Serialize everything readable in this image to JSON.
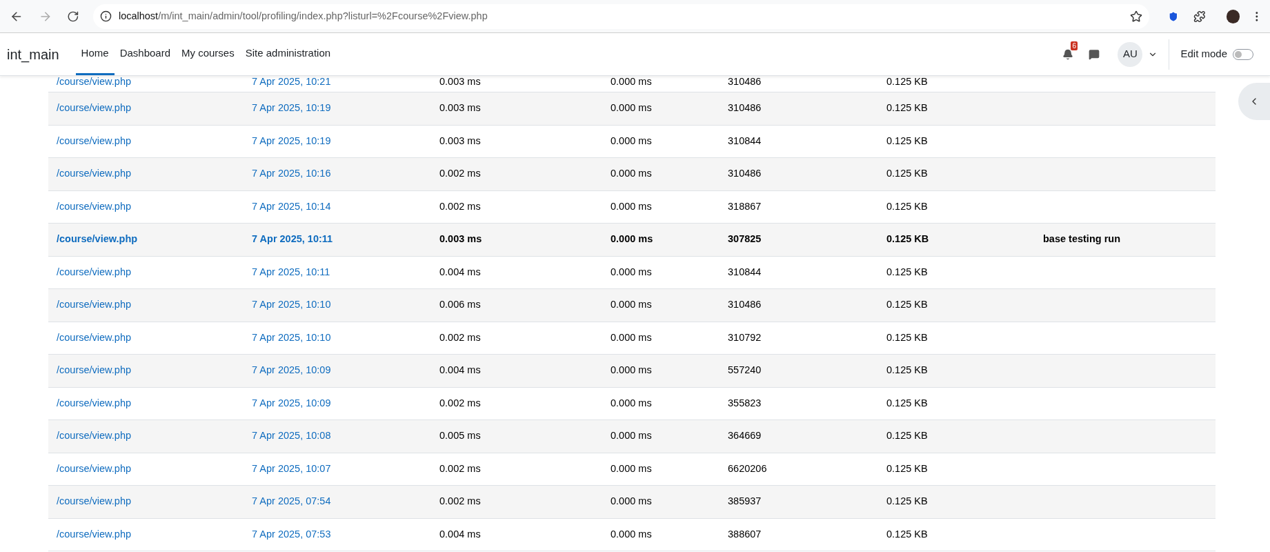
{
  "browser": {
    "url_host": "localhost",
    "url_path": "/m/int_main/admin/tool/profiling/index.php?listurl=%2Fcourse%2Fview.php"
  },
  "navbar": {
    "brand": "int_main",
    "items": [
      {
        "label": "Home",
        "selected": true
      },
      {
        "label": "Dashboard",
        "selected": false
      },
      {
        "label": "My courses",
        "selected": false
      },
      {
        "label": "Site administration",
        "selected": false
      }
    ],
    "notification_count": "6",
    "avatar_initials": "AU",
    "edit_mode": {
      "label": "Edit mode",
      "on": false
    }
  },
  "table": {
    "rows": [
      {
        "url": "/course/view.php",
        "date": "7 Apr 2025, 10:21",
        "column_3": "0.003 ms",
        "column_4": "0.000 ms",
        "column_5": "310486",
        "column_6": "0.125 KB",
        "reference": false
      },
      {
        "url": "/course/view.php",
        "date": "7 Apr 2025, 10:19",
        "column_3": "0.003 ms",
        "column_4": "0.000 ms",
        "column_5": "310486",
        "column_6": "0.125 KB",
        "reference": false
      },
      {
        "url": "/course/view.php",
        "date": "7 Apr 2025, 10:19",
        "column_3": "0.003 ms",
        "column_4": "0.000 ms",
        "column_5": "310844",
        "column_6": "0.125 KB",
        "reference": false
      },
      {
        "url": "/course/view.php",
        "date": "7 Apr 2025, 10:16",
        "column_3": "0.002 ms",
        "column_4": "0.000 ms",
        "column_5": "310486",
        "column_6": "0.125 KB",
        "reference": false
      },
      {
        "url": "/course/view.php",
        "date": "7 Apr 2025, 10:14",
        "column_3": "0.002 ms",
        "column_4": "0.000 ms",
        "column_5": "318867",
        "column_6": "0.125 KB",
        "reference": false
      },
      {
        "url": "/course/view.php",
        "date": "7 Apr 2025, 10:11",
        "column_3": "0.003 ms",
        "column_4": "0.000 ms",
        "column_5": "307825",
        "column_6": "0.125 KB",
        "column_7": "base testing run",
        "reference": true
      },
      {
        "url": "/course/view.php",
        "date": "7 Apr 2025, 10:11",
        "column_3": "0.004 ms",
        "column_4": "0.000 ms",
        "column_5": "310844",
        "column_6": "0.125 KB",
        "reference": false
      },
      {
        "url": "/course/view.php",
        "date": "7 Apr 2025, 10:10",
        "column_3": "0.006 ms",
        "column_4": "0.000 ms",
        "column_5": "310486",
        "column_6": "0.125 KB",
        "reference": false
      },
      {
        "url": "/course/view.php",
        "date": "7 Apr 2025, 10:10",
        "column_3": "0.002 ms",
        "column_4": "0.000 ms",
        "column_5": "310792",
        "column_6": "0.125 KB",
        "reference": false
      },
      {
        "url": "/course/view.php",
        "date": "7 Apr 2025, 10:09",
        "column_3": "0.004 ms",
        "column_4": "0.000 ms",
        "column_5": "557240",
        "column_6": "0.125 KB",
        "reference": false
      },
      {
        "url": "/course/view.php",
        "date": "7 Apr 2025, 10:09",
        "column_3": "0.002 ms",
        "column_4": "0.000 ms",
        "column_5": "355823",
        "column_6": "0.125 KB",
        "reference": false
      },
      {
        "url": "/course/view.php",
        "date": "7 Apr 2025, 10:08",
        "column_3": "0.005 ms",
        "column_4": "0.000 ms",
        "column_5": "364669",
        "column_6": "0.125 KB",
        "reference": false
      },
      {
        "url": "/course/view.php",
        "date": "7 Apr 2025, 10:07",
        "column_3": "0.002 ms",
        "column_4": "0.000 ms",
        "column_5": "6620206",
        "column_6": "0.125 KB",
        "reference": false
      },
      {
        "url": "/course/view.php",
        "date": "7 Apr 2025, 07:54",
        "column_3": "0.002 ms",
        "column_4": "0.000 ms",
        "column_5": "385937",
        "column_6": "0.125 KB",
        "reference": false
      },
      {
        "url": "/course/view.php",
        "date": "7 Apr 2025, 07:53",
        "column_3": "0.004 ms",
        "column_4": "0.000 ms",
        "column_5": "388607",
        "column_6": "0.125 KB",
        "reference": false
      }
    ]
  }
}
